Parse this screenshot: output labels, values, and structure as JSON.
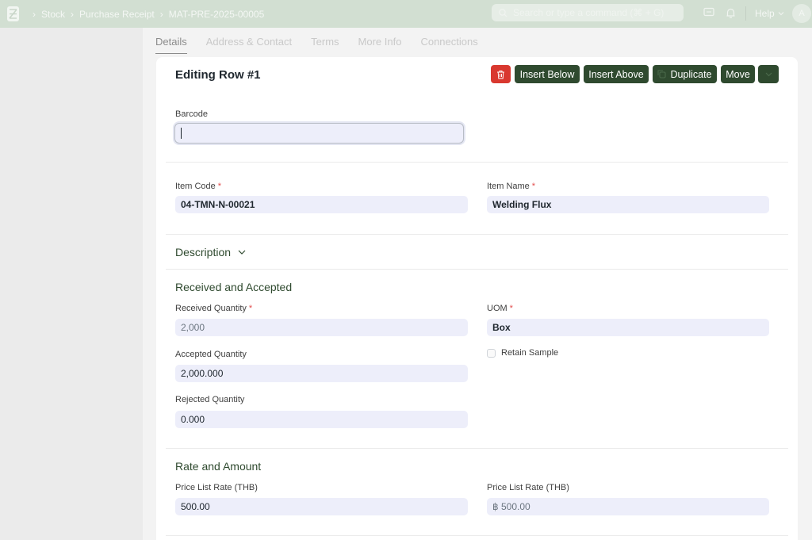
{
  "topbar": {
    "breadcrumbs": [
      "Stock",
      "Purchase Receipt",
      "MAT-PRE-2025-00005"
    ],
    "search_placeholder": "Search or type a command (⌘ + G)",
    "help_label": "Help",
    "avatar_initial": "A"
  },
  "tabs": [
    {
      "label": "Details",
      "active": true
    },
    {
      "label": "Address & Contact",
      "active": false
    },
    {
      "label": "Terms",
      "active": false
    },
    {
      "label": "More Info",
      "active": false
    },
    {
      "label": "Connections",
      "active": false
    }
  ],
  "row_editor": {
    "title": "Editing Row #1",
    "buttons": {
      "insert_below": "Insert Below",
      "insert_above": "Insert Above",
      "duplicate": "Duplicate",
      "move": "Move"
    }
  },
  "fields": {
    "barcode": {
      "label": "Barcode",
      "value": ""
    },
    "item_code": {
      "label": "Item Code",
      "value": "04-TMN-N-00021"
    },
    "item_name": {
      "label": "Item Name",
      "value": "Welding Flux"
    },
    "received_qty": {
      "label": "Received Quantity",
      "value": "2,000"
    },
    "uom": {
      "label": "UOM",
      "value": "Box"
    },
    "accepted_qty": {
      "label": "Accepted Quantity",
      "value": "2,000.000"
    },
    "retain_sample": {
      "label": "Retain Sample",
      "checked": false
    },
    "rejected_qty": {
      "label": "Rejected Quantity",
      "value": "0.000"
    },
    "price_list_rate": {
      "label": "Price List Rate (THB)",
      "value": "500.00"
    },
    "price_list_rate_company": {
      "label": "Price List Rate (THB)",
      "value": "฿ 500.00"
    }
  },
  "sections": {
    "description": "Description",
    "received_accepted": "Received and Accepted",
    "rate_amount": "Rate and Amount"
  },
  "colors": {
    "primary_button": "#2f4a2f",
    "danger_button": "#d9382f",
    "section_heading": "#2f4a2f",
    "field_bg": "#edeefa",
    "topbar_bg": "#d2dfd2"
  }
}
